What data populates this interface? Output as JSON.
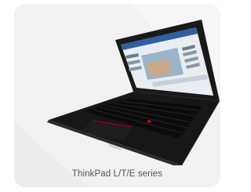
{
  "product": {
    "caption": "ThinkPad L/T/E series",
    "brand_mark": "ThinkPad",
    "image_icon": "laptop-icon",
    "colors": {
      "card_background": "#f1f1f1",
      "caption_text": "#555555",
      "laptop_body": "#141414",
      "trackpoint": "#d0021b"
    }
  }
}
